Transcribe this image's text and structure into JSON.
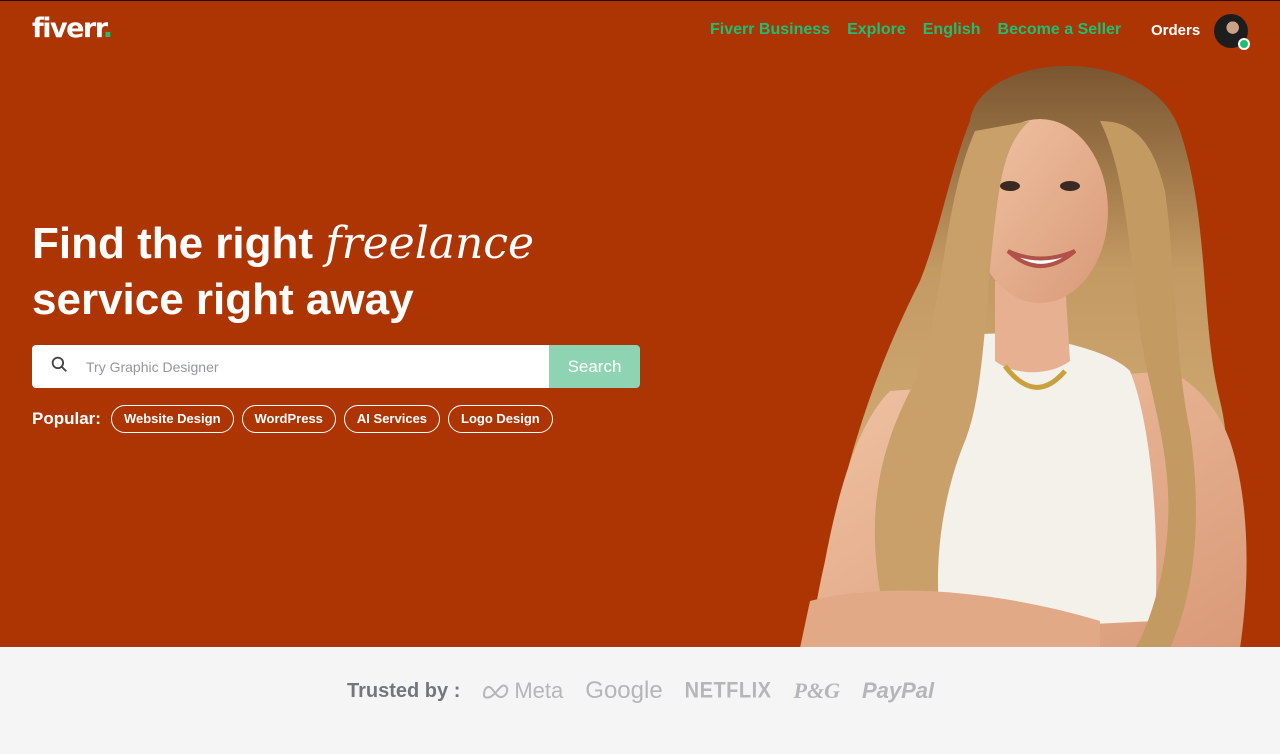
{
  "header": {
    "logo_text": "fiverr",
    "logo_dot": ".",
    "nav": [
      {
        "label": "Fiverr Business"
      },
      {
        "label": "Explore"
      },
      {
        "label": "English"
      },
      {
        "label": "Become a Seller"
      }
    ],
    "orders_label": "Orders",
    "avatar_status": "online"
  },
  "hero": {
    "headline_part1": "Find the right ",
    "headline_emphasis": "freelance",
    "headline_part2": " service right away",
    "background_color": "#ad3504",
    "search": {
      "placeholder": "Try Graphic Designer",
      "value": "",
      "button_label": "Search",
      "icon": "search-icon"
    },
    "popular": {
      "label": "Popular:",
      "tags": [
        "Website Design",
        "WordPress",
        "AI Services",
        "Logo Design"
      ]
    }
  },
  "trusted": {
    "label": "Trusted by :",
    "brands": [
      "Meta",
      "Google",
      "NETFLIX",
      "P&G",
      "PayPal"
    ]
  },
  "colors": {
    "brand_green": "#1dbf73",
    "search_button": "#8fd4b2",
    "hero_bg": "#ad3504",
    "trusted_bg": "#f5f5f5"
  }
}
